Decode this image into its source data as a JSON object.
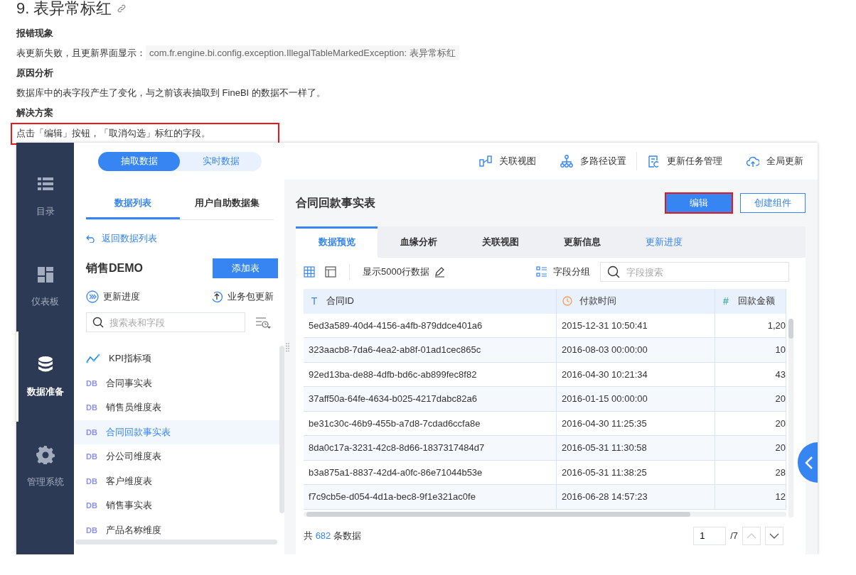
{
  "article": {
    "heading": "9. 表异常标红",
    "sections": [
      {
        "title": "报错现象",
        "text": "表更新失败，且更新界面显示：",
        "code": "com.fr.engine.bi.config.exception.IllegalTableMarkedException: 表异常标红",
        "highlighted": false
      },
      {
        "title": "原因分析",
        "text": "数据库中的表字段产生了变化，与之前该表抽取到 FineBI 的数据不一样了。",
        "highlighted": false
      },
      {
        "title": "解决方案",
        "text": "点击「编辑」按钮，「取消勾选」标红的字段。",
        "highlighted": true
      }
    ]
  },
  "app": {
    "nav": [
      {
        "label": "目录",
        "selected": false
      },
      {
        "label": "仪表板",
        "selected": false
      },
      {
        "label": "数据准备",
        "selected": true
      },
      {
        "label": "管理系统",
        "selected": false
      }
    ],
    "mode_toggle": [
      {
        "label": "抽取数据",
        "selected": true
      },
      {
        "label": "实时数据",
        "selected": false
      }
    ],
    "toolbar": [
      "关联视图",
      "多路径设置",
      "更新任务管理",
      "全局更新"
    ],
    "list_tabs": [
      {
        "label": "数据列表",
        "selected": true
      },
      {
        "label": "用户自助数据集",
        "selected": false
      }
    ],
    "back_link": "返回数据列表",
    "package": {
      "name": "销售DEMO",
      "add_button": "添加表"
    },
    "actions": [
      "更新进度",
      "业务包更新"
    ],
    "search": {
      "placeholder": "搜索表和字段"
    },
    "tables": [
      {
        "name": "KPI指标项",
        "kind": "kpi",
        "selected": false
      },
      {
        "name": "合同事实表",
        "kind": "db",
        "mark": "DB",
        "selected": false
      },
      {
        "name": "销售员维度表",
        "kind": "db",
        "mark": "DB",
        "selected": false
      },
      {
        "name": "合同回款事实表",
        "kind": "db",
        "mark": "DB",
        "selected": true
      },
      {
        "name": "分公司维度表",
        "kind": "db",
        "mark": "DB",
        "selected": false
      },
      {
        "name": "客户维度表",
        "kind": "db",
        "mark": "DB",
        "selected": false
      },
      {
        "name": "销售事实表",
        "kind": "db",
        "mark": "DB",
        "selected": false
      },
      {
        "name": "产品名称维度",
        "kind": "db",
        "mark": "DB",
        "selected": false
      }
    ],
    "detail": {
      "title": "合同回款事实表",
      "buttons": [
        {
          "label": "编辑",
          "kind": "primary",
          "highlighted": true
        },
        {
          "label": "创建组件",
          "kind": "outline",
          "highlighted": false
        }
      ],
      "tabs": [
        {
          "label": "数据预览",
          "kind": "tab",
          "selected": true
        },
        {
          "label": "血缘分析",
          "kind": "tab",
          "selected": false
        },
        {
          "label": "关联视图",
          "kind": "tab",
          "selected": false
        },
        {
          "label": "更新信息",
          "kind": "tab",
          "selected": false
        },
        {
          "label": "更新进度",
          "kind": "link",
          "selected": false
        }
      ],
      "row_limit": "显示5000行数据",
      "group_button": "字段分组",
      "field_search": {
        "placeholder": "字段搜索"
      },
      "table": {
        "columns": [
          {
            "name": "合同ID",
            "kind": "text",
            "mark": "T"
          },
          {
            "name": "付款时间",
            "kind": "date"
          },
          {
            "name": "回款金额",
            "kind": "number",
            "mark": "#"
          }
        ],
        "rows": [
          [
            "5ed3a589-40d4-4156-a4fb-879ddce401a6",
            "2015-12-31 10:50:41",
            "1,20"
          ],
          [
            "323aacb8-7da6-4ea2-ab8f-01ad1cec865c",
            "2016-08-03 00:00:00",
            "10"
          ],
          [
            "92ed13ba-de88-4dfb-bd6c-ab899fec8f82",
            "2016-04-30 10:21:34",
            "43"
          ],
          [
            "37aff50a-64fe-4634-b025-4217dabc82a6",
            "2016-01-15 00:00:00",
            "20"
          ],
          [
            "be31c30c-46b9-455b-a7d8-7cdad6ccfa8e",
            "2016-04-30 11:25:35",
            "20"
          ],
          [
            "8da0c17a-3231-42c8-8d66-1837317484d7",
            "2016-05-31 11:30:58",
            "20"
          ],
          [
            "b3a875a1-8837-42d4-a0fc-86e71044b53e",
            "2016-05-31 11:38:25",
            "28"
          ],
          [
            "f7c9cb5e-d054-4d1a-bec8-9f1e321ac0fe",
            "2016-06-28 14:57:23",
            "12"
          ]
        ]
      },
      "footer": {
        "prefix": "共",
        "count": "682",
        "suffix": "条数据",
        "page": "1",
        "page_total": "/7"
      }
    }
  }
}
